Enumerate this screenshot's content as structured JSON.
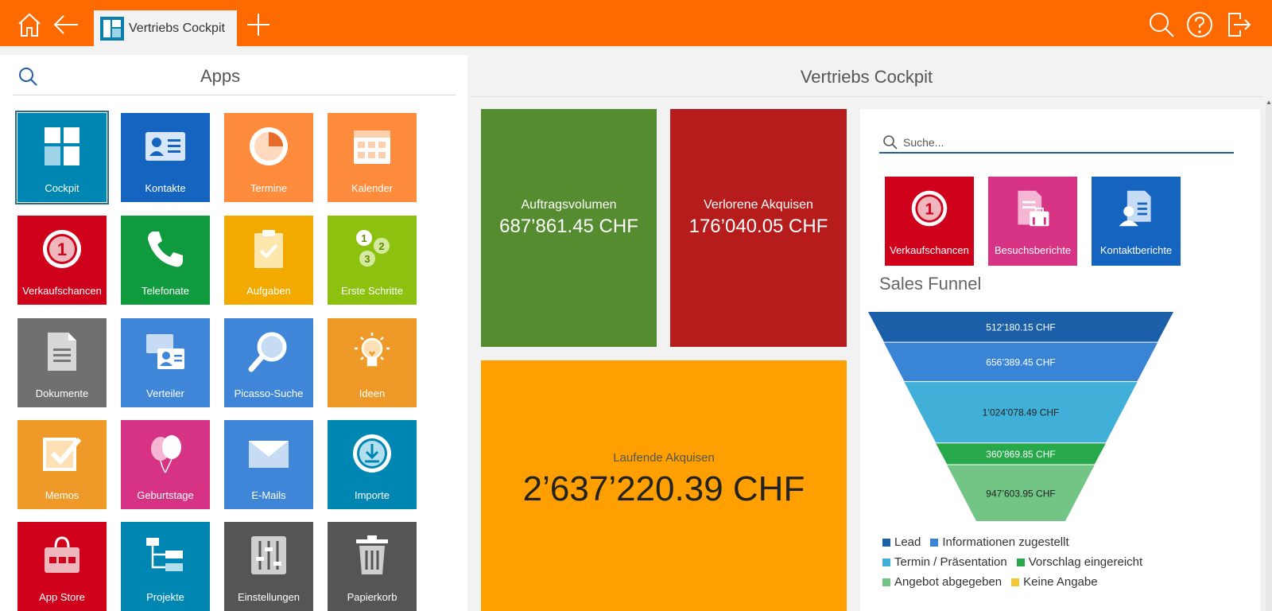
{
  "topbar": {
    "tab_label": "Vertriebs Cockpit",
    "bg_color": "#ff6a00"
  },
  "apps_panel": {
    "title": "Apps",
    "tiles": [
      {
        "label": "Cockpit",
        "icon": "cockpit-icon",
        "color": "#0086b3"
      },
      {
        "label": "Kontakte",
        "icon": "contact-card-icon",
        "color": "#1565c0"
      },
      {
        "label": "Termine",
        "icon": "clock-chart-icon",
        "color": "#ff8c3d"
      },
      {
        "label": "Kalender",
        "icon": "calendar-icon",
        "color": "#ff8c3d"
      },
      {
        "label": "Verkaufschancen",
        "icon": "opportunity-icon",
        "color": "#d0021b"
      },
      {
        "label": "Telefonate",
        "icon": "phone-icon",
        "color": "#109a3e"
      },
      {
        "label": "Aufgaben",
        "icon": "clipboard-check-icon",
        "color": "#f2a900"
      },
      {
        "label": "Erste Schritte",
        "icon": "first-steps-icon",
        "color": "#8cc10f"
      },
      {
        "label": "Dokumente",
        "icon": "document-icon",
        "color": "#707070"
      },
      {
        "label": "Verteiler",
        "icon": "distribution-list-icon",
        "color": "#3f86d9"
      },
      {
        "label": "Picasso-Suche",
        "icon": "magnifier-icon",
        "color": "#3f86d9"
      },
      {
        "label": "Ideen",
        "icon": "lightbulb-icon",
        "color": "#ef9a28"
      },
      {
        "label": "Memos",
        "icon": "checkbox-icon",
        "color": "#ef9a28"
      },
      {
        "label": "Geburtstage",
        "icon": "balloons-icon",
        "color": "#d63384"
      },
      {
        "label": "E-Mails",
        "icon": "envelope-icon",
        "color": "#3f86d9"
      },
      {
        "label": "Importe",
        "icon": "import-icon",
        "color": "#0086b3"
      },
      {
        "label": "App Store",
        "icon": "shopping-bag-icon",
        "color": "#d0021b"
      },
      {
        "label": "Projekte",
        "icon": "project-tree-icon",
        "color": "#0086b3"
      },
      {
        "label": "Einstellungen",
        "icon": "sliders-icon",
        "color": "#555555"
      },
      {
        "label": "Papierkorb",
        "icon": "trash-icon",
        "color": "#555555"
      }
    ]
  },
  "cockpit": {
    "title": "Vertriebs Cockpit",
    "kpis": [
      {
        "label": "Auftragsvolumen",
        "value": "687’861.45 CHF",
        "color": "#548c2f"
      },
      {
        "label": "Verlorene Akquisen",
        "value": "176’040.05 CHF",
        "color": "#b71c1c"
      },
      {
        "label": "Laufende Akquisen",
        "value": "2’637’220.39 CHF",
        "color": "#ffa000"
      }
    ],
    "search_placeholder": "Suche...",
    "quick_tiles": [
      {
        "label": "Verkaufschancen",
        "icon": "opportunity-icon",
        "color": "#d0021b"
      },
      {
        "label": "Besuchsberichte",
        "icon": "visit-report-icon",
        "color": "#d63384"
      },
      {
        "label": "Kontaktberichte",
        "icon": "contact-report-icon",
        "color": "#1565c0"
      }
    ],
    "funnel_title": "Sales Funnel"
  },
  "chart_data": {
    "type": "funnel",
    "title": "Sales Funnel",
    "categories": [
      "Lead",
      "Informationen zugestellt",
      "Termin / Präsentation",
      "Vorschlag eingereicht",
      "Angebot abgegeben",
      "Keine Angabe"
    ],
    "series": [
      {
        "values": [
          512180.15,
          656389.45,
          1024078.49,
          360869.85,
          947603.95,
          0
        ]
      }
    ],
    "data_labels": [
      "512’180.15 CHF",
      "656’389.45 CHF",
      "1’024’078.49 CHF",
      "360’869.85 CHF",
      "947’603.95 CHF"
    ],
    "colors": [
      "#1a5fa8",
      "#3a84d6",
      "#40b0d8",
      "#27a84a",
      "#72c585",
      "#f3c633"
    ],
    "legend": {
      "position": "bottom"
    }
  }
}
